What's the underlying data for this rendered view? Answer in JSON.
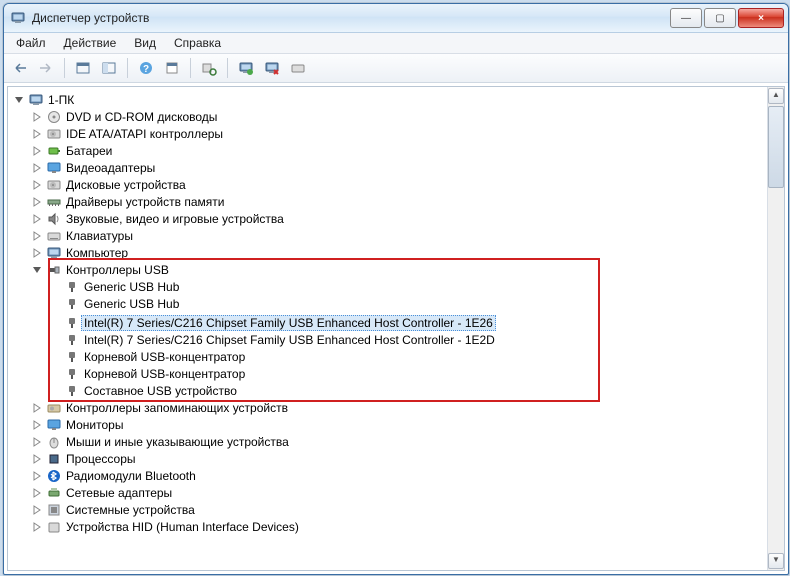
{
  "window": {
    "title": "Диспетчер устройств",
    "min": "—",
    "max": "▢",
    "close": "×"
  },
  "menu": {
    "file": "Файл",
    "action": "Действие",
    "view": "Вид",
    "help": "Справка"
  },
  "tree": {
    "root": "1-ПК",
    "items": {
      "dvd": "DVD и CD-ROM дисководы",
      "ide": "IDE ATA/ATAPI контроллеры",
      "bat": "Батареи",
      "vid": "Видеоадаптеры",
      "disk": "Дисковые устройства",
      "memdrv": "Драйверы устройств памяти",
      "sound": "Звуковые, видео и игровые устройства",
      "keyb": "Клавиатуры",
      "comp": "Компьютер",
      "usb": "Контроллеры USB",
      "usb_children": {
        "g1": "Generic USB Hub",
        "g2": "Generic USB Hub",
        "c1": "Intel(R) 7 Series/C216 Chipset Family USB Enhanced Host Controller - 1E26",
        "c2": "Intel(R) 7 Series/C216 Chipset Family USB Enhanced Host Controller - 1E2D",
        "rh1": "Корневой USB-концентратор",
        "rh2": "Корневой USB-концентратор",
        "comp": "Составное USB устройство"
      },
      "stor": "Контроллеры запоминающих устройств",
      "mon": "Мониторы",
      "mouse": "Мыши и иные указывающие устройства",
      "cpu": "Процессоры",
      "bt": "Радиомодули Bluetooth",
      "net": "Сетевые адаптеры",
      "sys": "Системные устройства",
      "hid": "Устройства HID (Human Interface Devices)"
    }
  }
}
